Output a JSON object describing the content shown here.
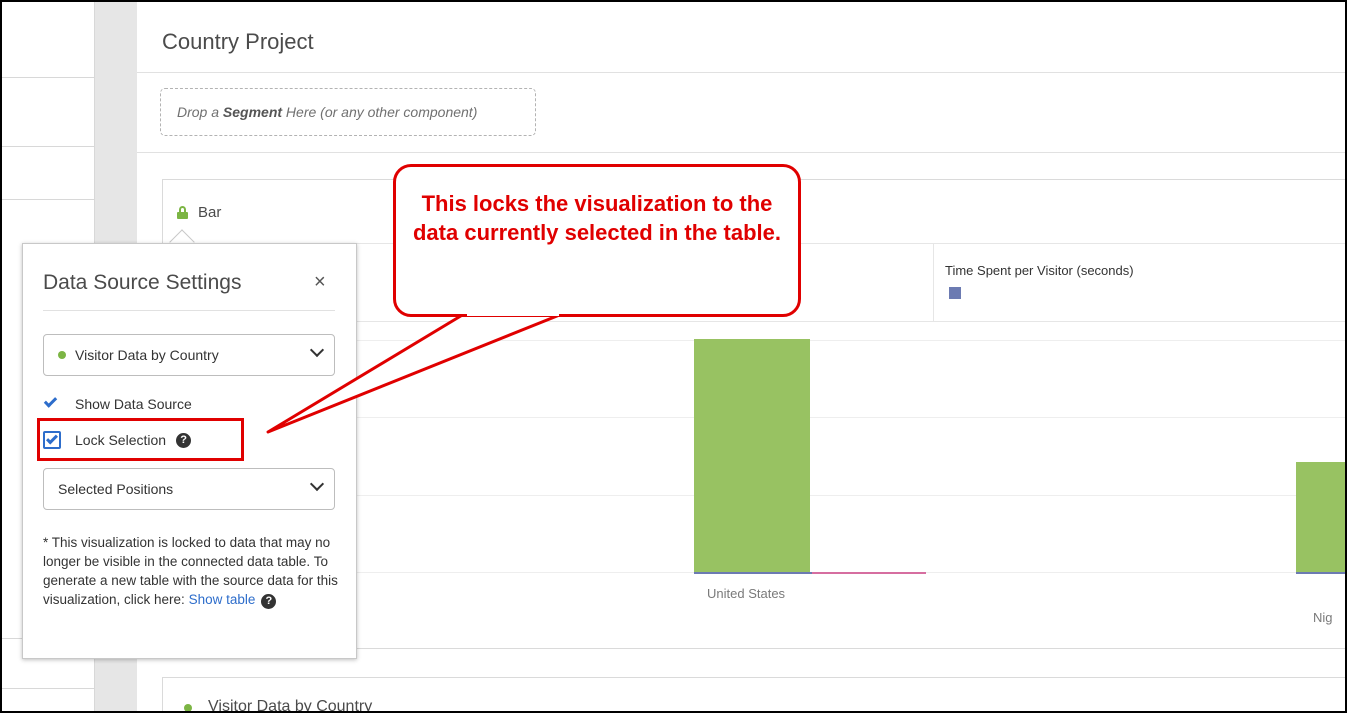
{
  "project": {
    "title": "Country Project",
    "segment_drop": {
      "prefix": "Drop a ",
      "bold": "Segment",
      "suffix": " Here (or any other component)"
    }
  },
  "visualization": {
    "title": "Bar",
    "legend_metric": "Time Spent per Visitor (seconds)",
    "series_color": "#6c7bb2",
    "bar_color": "#98c262"
  },
  "chart_data": {
    "type": "bar",
    "categories": [
      "United States",
      "Nig"
    ],
    "series": [
      {
        "values": [
          100,
          47
        ],
        "color": "#98c262"
      }
    ],
    "title": "Bar",
    "legend": [
      "Time Spent per Visitor (seconds)"
    ]
  },
  "popover": {
    "title": "Data Source Settings",
    "close_symbol": "×",
    "data_source_value": "Visitor Data by Country",
    "show_data_source_label": "Show Data Source",
    "lock_selection_label": "Lock Selection",
    "help_symbol": "?",
    "selection_mode_value": "Selected Positions",
    "note_text": "* This visualization is locked to data that may no longer be visible in the connected data table. To generate a new table with the source data for this visualization, click here: ",
    "note_link": "Show table"
  },
  "callout": {
    "text": "This locks the visualization to the data currently selected in the table.",
    "color": "#e00000"
  },
  "second_panel": {
    "title": "Visitor Data by Country"
  }
}
